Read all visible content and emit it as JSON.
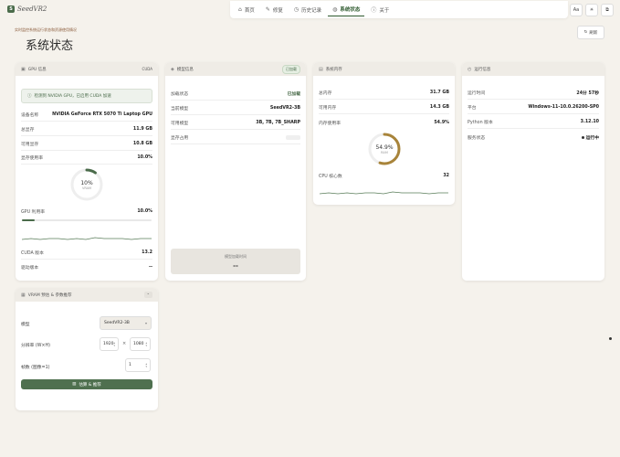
{
  "app": {
    "logo_letter": "S",
    "name": "SeedVR2"
  },
  "nav": [
    {
      "icon": "⌂",
      "label": "首页",
      "active": false
    },
    {
      "icon": "✎",
      "label": "修复",
      "active": false
    },
    {
      "icon": "◷",
      "label": "历史记录",
      "active": false
    },
    {
      "icon": "◍",
      "label": "系统状态",
      "active": true
    },
    {
      "icon": "ⓘ",
      "label": "关于",
      "active": false
    }
  ],
  "topright": {
    "font_btn": "Aa",
    "theme_btn": "☀",
    "copy_btn": "⧉"
  },
  "page": {
    "subtitle": "实时监控系统运行状态和资源使用情况",
    "title": "系统状态",
    "refresh": "刷新"
  },
  "gpu": {
    "header": "GPU 信息",
    "badge": "CUDA",
    "notice": "检测到 NVIDIA GPU，已启用 CUDA 加速",
    "rows": [
      {
        "k": "设备名称",
        "v": "NVIDIA GeForce RTX 5070 Ti Laptop GPU"
      },
      {
        "k": "总显存",
        "v": "11.9 GB"
      },
      {
        "k": "可用显存",
        "v": "10.8 GB"
      },
      {
        "k": "显存使用率",
        "v": "10.0%"
      }
    ],
    "gauge": {
      "value": "10%",
      "label": "VRAM",
      "fraction": 0.1
    },
    "util_label": "GPU 利用率",
    "util_value": "10.0%",
    "util_fraction": 0.1,
    "cuda_label": "CUDA 版本",
    "cuda_value": "13.2",
    "driver_label": "驱动版本",
    "driver_value": "--"
  },
  "model": {
    "header": "模型信息",
    "badge": "已加载",
    "rows": [
      {
        "k": "加载状态",
        "v": "已加载"
      },
      {
        "k": "当前模型",
        "v": "SeedVR2-3B"
      },
      {
        "k": "可用模型",
        "v": "3B, 7B, 7B_SHARP"
      },
      {
        "k": "显存占用",
        "v": ""
      }
    ],
    "footer_label": "模型加载时间",
    "footer_value": "--"
  },
  "memory": {
    "header": "系统内存",
    "rows": [
      {
        "k": "总内存",
        "v": "31.7 GB"
      },
      {
        "k": "可用内存",
        "v": "14.3 GB"
      },
      {
        "k": "内存使用率",
        "v": "54.9%"
      }
    ],
    "gauge": {
      "value": "54.9%",
      "label": "RAM",
      "fraction": 0.549
    },
    "cpu_label": "CPU 核心数",
    "cpu_value": "32"
  },
  "runtime": {
    "header": "运行信息",
    "rows": [
      {
        "k": "运行时间",
        "v": "24分 57秒"
      },
      {
        "k": "平台",
        "v": "Windows-11-10.0.26200-SP0"
      },
      {
        "k": "Python 版本",
        "v": "3.12.10"
      },
      {
        "k": "服务状态",
        "v": "运行中"
      }
    ]
  },
  "vram": {
    "header": "VRAM 预估 & 参数推荐",
    "collapse": "⌃",
    "model_label": "模型",
    "model_value": "SeedVR2-3B",
    "res_label": "分辨率 (W×H)",
    "width": "1920",
    "times": "×",
    "height": "1080",
    "frames_label": "帧数 (图像=1)",
    "frames": "1",
    "button": "估算 & 推荐"
  },
  "colors": {
    "accent": "#4a6b4a",
    "background": "#f5f2ec",
    "card": "#ffffff"
  }
}
